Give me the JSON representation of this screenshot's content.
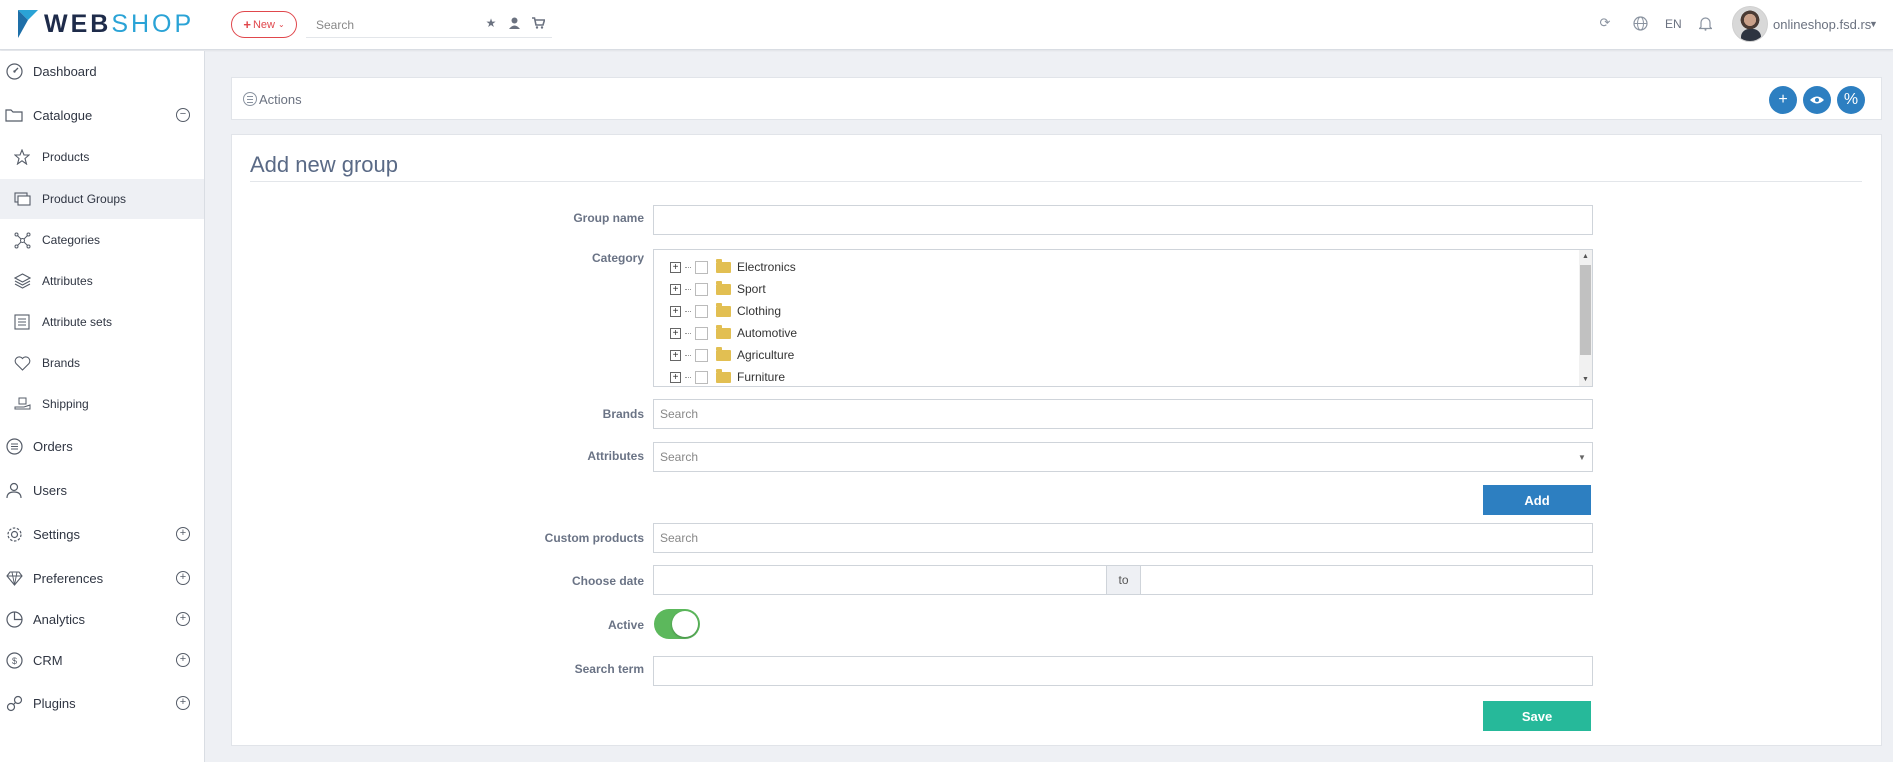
{
  "brand": {
    "name_part1": "WEB",
    "name_part2": "SHOP",
    "accent": "#2aa3d6",
    "dark": "#1e2b4a"
  },
  "topbar": {
    "new_label": "New",
    "search_placeholder": "Search",
    "icons": [
      "star-icon",
      "user-icon",
      "cart-icon"
    ],
    "right_icons": [
      "refresh-icon",
      "globe-icon",
      "bell-icon"
    ],
    "language": "EN",
    "user": "onlineshop.fsd.rs"
  },
  "sidebar": {
    "items": [
      {
        "label": "Dashboard",
        "icon": "dashboard-icon"
      },
      {
        "label": "Catalogue",
        "icon": "folder-icon",
        "toggle": "−"
      },
      {
        "label": "Products",
        "icon": "star-icon"
      },
      {
        "label": "Product Groups",
        "icon": "cards-icon"
      },
      {
        "label": "Categories",
        "icon": "network-icon"
      },
      {
        "label": "Attributes",
        "icon": "layers-icon"
      },
      {
        "label": "Attribute sets",
        "icon": "list-icon"
      },
      {
        "label": "Brands",
        "icon": "heart-icon"
      },
      {
        "label": "Shipping",
        "icon": "shipping-icon"
      },
      {
        "label": "Orders",
        "icon": "orders-icon"
      },
      {
        "label": "Users",
        "icon": "users-icon"
      },
      {
        "label": "Settings",
        "icon": "gear-icon",
        "toggle": "+"
      },
      {
        "label": "Preferences",
        "icon": "diamond-icon",
        "toggle": "+"
      },
      {
        "label": "Analytics",
        "icon": "pie-chart-icon",
        "toggle": "+"
      },
      {
        "label": "CRM",
        "icon": "crm-icon",
        "toggle": "+"
      },
      {
        "label": "Plugins",
        "icon": "plug-icon",
        "toggle": "+"
      }
    ]
  },
  "actions": {
    "label": "Actions",
    "buttons": [
      "+",
      "👁",
      "%"
    ],
    "button_color": "#2d7fc1"
  },
  "form": {
    "title": "Add new group",
    "group_name_label": "Group name",
    "category_label": "Category",
    "categories": [
      "Electronics",
      "Sport",
      "Clothing",
      "Automotive",
      "Agriculture",
      "Furniture"
    ],
    "brands_label": "Brands",
    "brands_placeholder": "Search",
    "attributes_label": "Attributes",
    "attributes_placeholder": "Search",
    "add_label": "Add",
    "custom_products_label": "Custom products",
    "custom_products_placeholder": "Search",
    "choose_date_label": "Choose date",
    "date_separator": "to",
    "active_label": "Active",
    "active": true,
    "search_term_label": "Search term",
    "save_label": "Save",
    "save_color": "#26b99a",
    "toggle_color": "#5cb85c"
  }
}
